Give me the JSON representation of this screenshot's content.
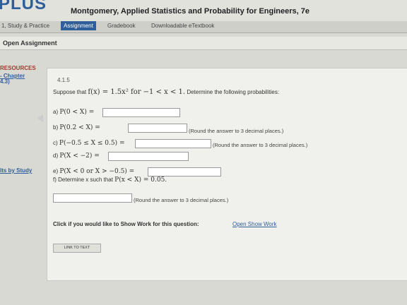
{
  "header": {
    "logo": "PLUS",
    "book_title": "Montgomery, Applied Statistics and Probability for Engineers, 7e"
  },
  "nav": {
    "items": [
      {
        "label": "1, Study & Practice"
      },
      {
        "label": "Assignment"
      },
      {
        "label": "Gradebook"
      },
      {
        "label": "Downloadable eTextbook"
      }
    ],
    "active": "Assignment"
  },
  "subbar": {
    "label": "Open Assignment"
  },
  "sidebar": {
    "title": "RESOURCES",
    "links": [
      "- Chapter",
      "4.3)",
      "lts by Study"
    ]
  },
  "question": {
    "number": "4.1.5",
    "prompt_prefix": "Suppose that",
    "prompt_math": "f(x) = 1.5x² for −1 < x < 1.",
    "prompt_suffix": "Determine the following probabilities:",
    "parts": [
      {
        "label": "a)",
        "expr": "P(0 < X) =",
        "value": "",
        "note": ""
      },
      {
        "label": "b)",
        "expr": "P(0.2 < X) =",
        "value": "",
        "note": "(Round the answer to 3 decimal places.)"
      },
      {
        "label": "c)",
        "expr": "P(−0.5 ≤ X ≤ 0.5) =",
        "value": "",
        "note": "(Round the answer to 3 decimal places.)"
      },
      {
        "label": "d)",
        "expr": "P(X < −2) =",
        "value": "",
        "note": ""
      },
      {
        "label": "e)",
        "expr": "P(X < 0 or X > −0.5) =",
        "value": "",
        "note": ""
      }
    ],
    "part_f": {
      "label": "f)",
      "text": "Determine x such that",
      "math": "P(x < X) = 0.05.",
      "value": "",
      "note": "(Round the answer to 3 decimal places.)"
    }
  },
  "showwork": {
    "prompt": "Click if you would like to Show Work for this question:",
    "link": "Open Show Work"
  },
  "link_to_text": "LINK TO TEXT"
}
